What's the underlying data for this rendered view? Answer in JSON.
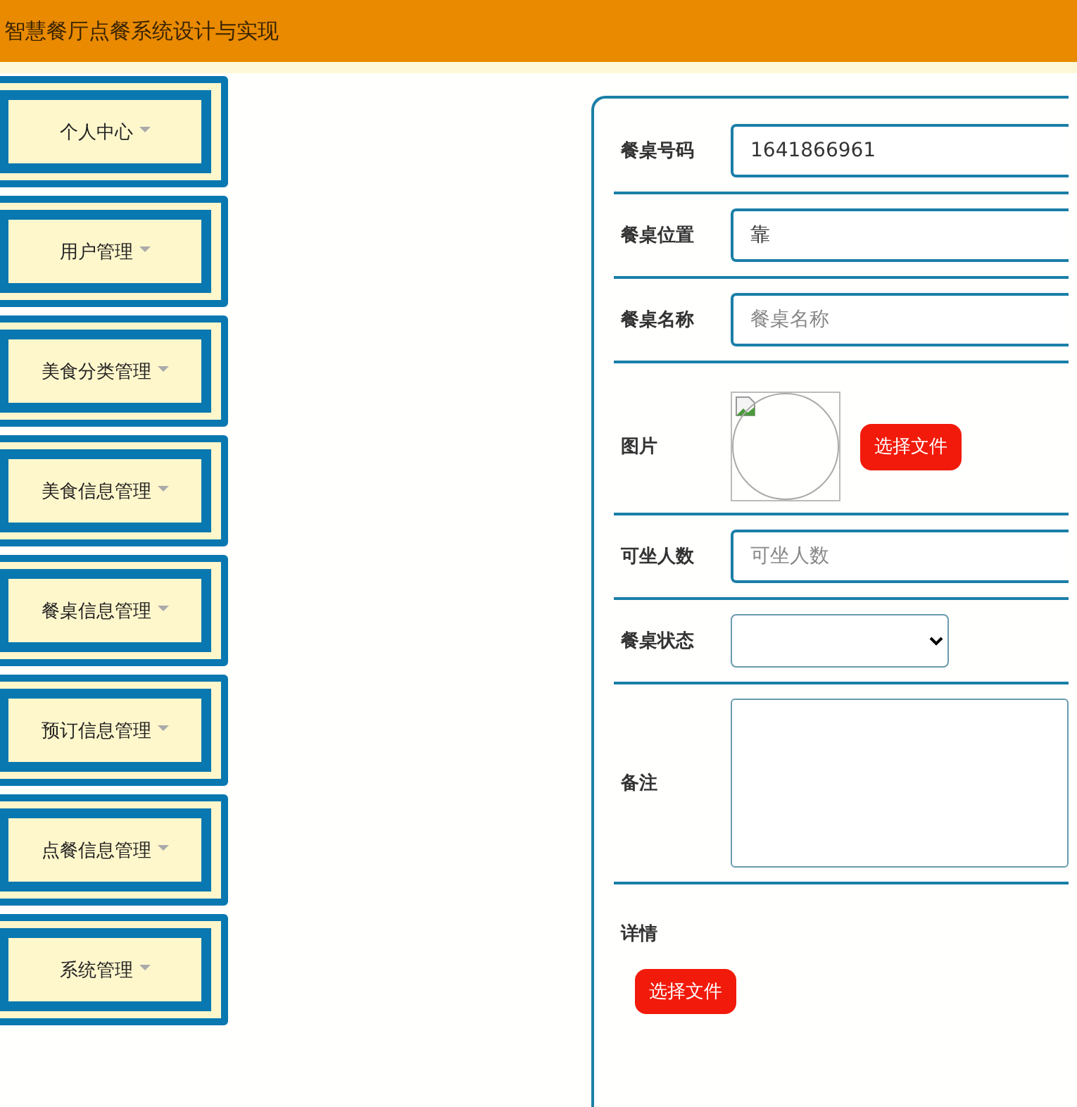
{
  "header": {
    "title": "智慧餐厅点餐系统设计与实现"
  },
  "sidebar": {
    "items": [
      {
        "label": "个人中心"
      },
      {
        "label": "用户管理"
      },
      {
        "label": "美食分类管理"
      },
      {
        "label": "美食信息管理"
      },
      {
        "label": "餐桌信息管理"
      },
      {
        "label": "预订信息管理"
      },
      {
        "label": "点餐信息管理"
      },
      {
        "label": "系统管理"
      }
    ]
  },
  "form": {
    "fields": [
      {
        "kind": "text",
        "label": "餐桌号码",
        "value": "1641866961"
      },
      {
        "kind": "text",
        "label": "餐桌位置",
        "value": "靠"
      },
      {
        "kind": "text",
        "label": "餐桌名称",
        "placeholder": "餐桌名称"
      },
      {
        "kind": "image",
        "label": "图片",
        "button": "选择文件"
      },
      {
        "kind": "text",
        "label": "可坐人数",
        "placeholder": "可坐人数"
      },
      {
        "kind": "select",
        "label": "餐桌状态"
      },
      {
        "kind": "textarea",
        "label": "备注"
      },
      {
        "kind": "editor",
        "label": "详情",
        "button": "选择文件"
      }
    ]
  }
}
